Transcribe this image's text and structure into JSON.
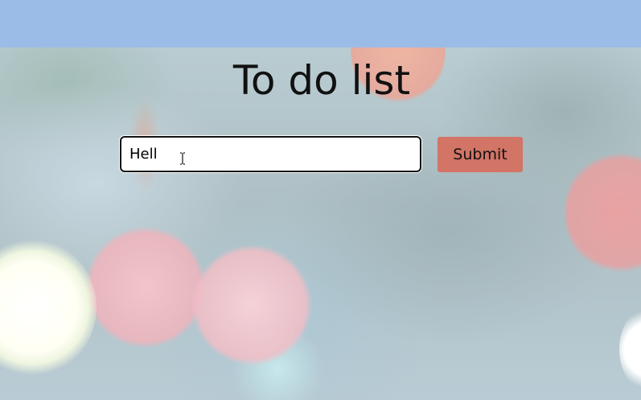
{
  "app": {
    "title": "To do list"
  },
  "form": {
    "input_value": "Hell",
    "input_placeholder": "",
    "submit_label": "Submit"
  },
  "colors": {
    "topbar": "#9bbce6",
    "submit_button": "#d27466",
    "input_border": "#111111"
  },
  "icons": {
    "cursor": "text-cursor-icon"
  }
}
